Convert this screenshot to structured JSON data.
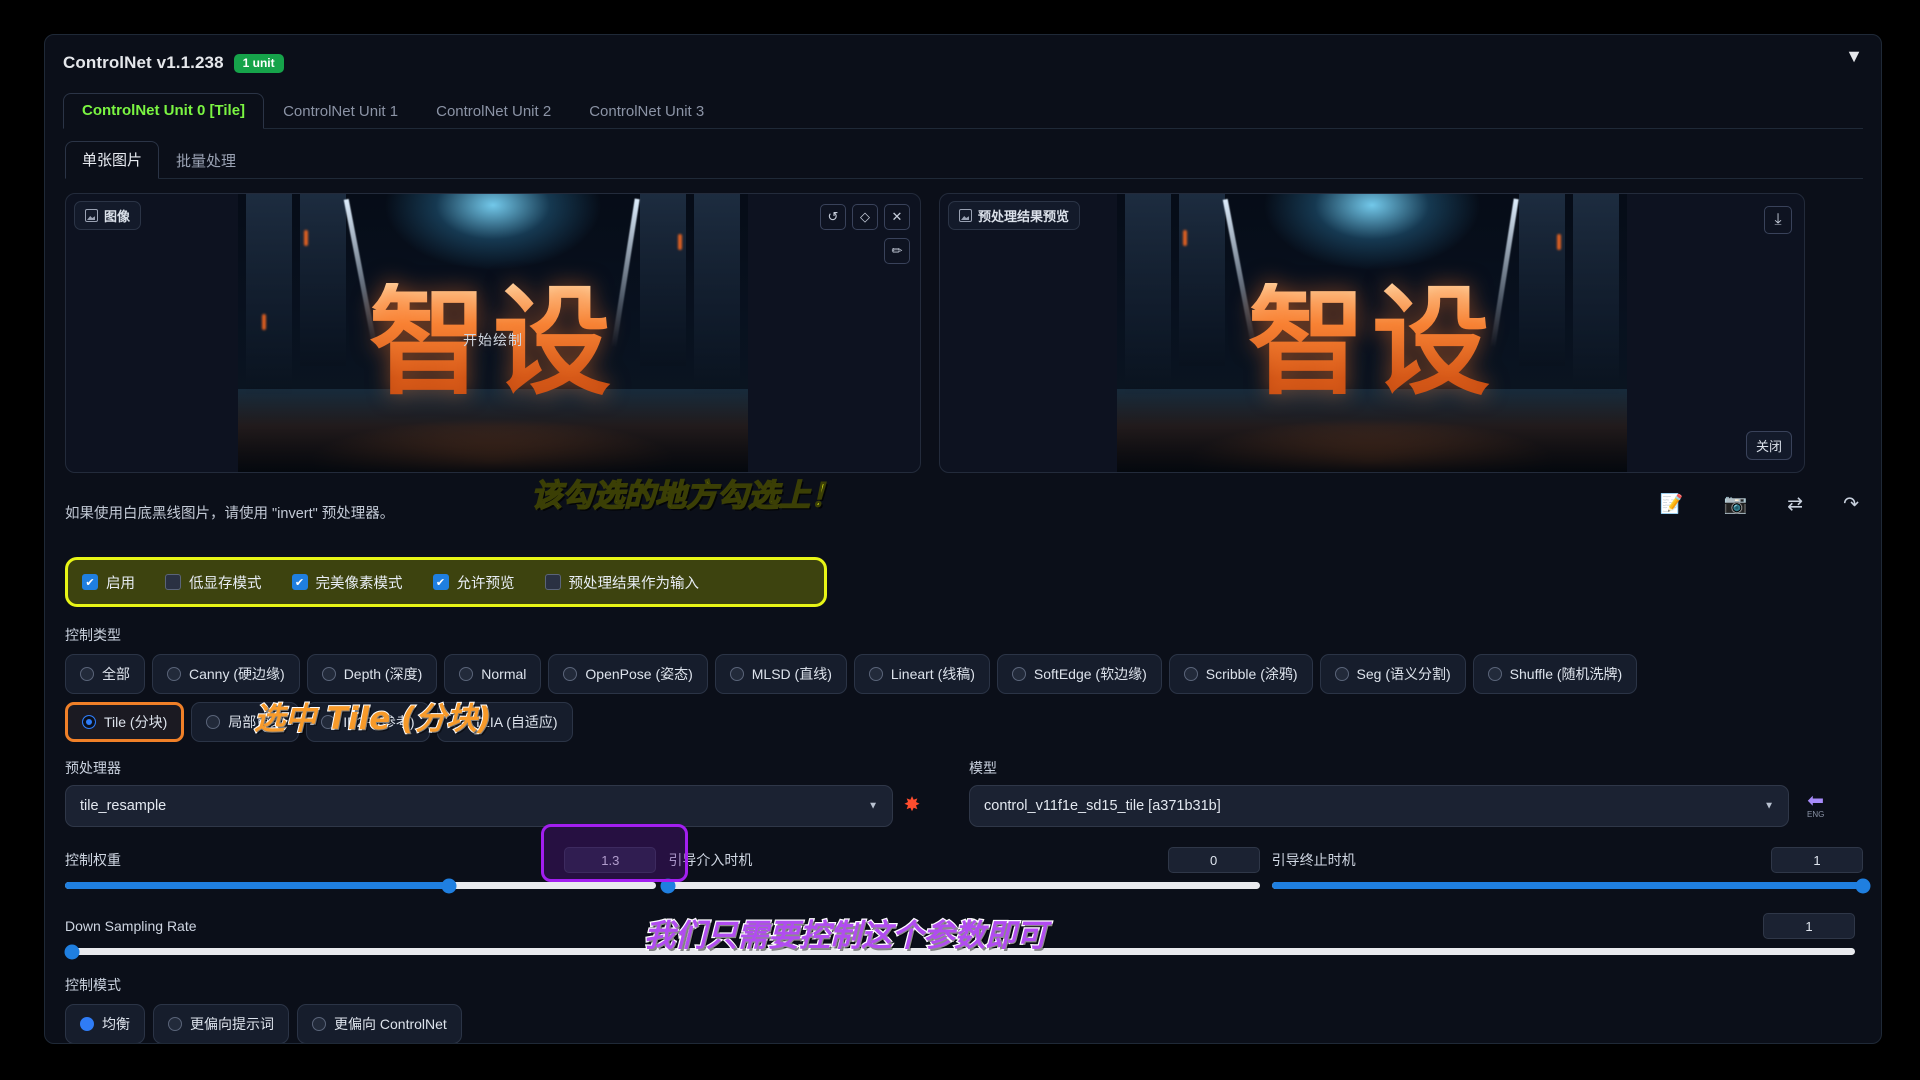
{
  "panel": {
    "title": "ControlNet v1.1.238",
    "badge": "1 unit",
    "collapse_icon": "▼",
    "badge_color": "#16a34a",
    "accent_green": "#7bf542"
  },
  "unit_tabs": [
    {
      "label": "ControlNet Unit 0 [Tile]",
      "active": true
    },
    {
      "label": "ControlNet Unit 1",
      "active": false
    },
    {
      "label": "ControlNet Unit 2",
      "active": false
    },
    {
      "label": "ControlNet Unit 3",
      "active": false
    }
  ],
  "sub_tabs": [
    {
      "label": "单张图片",
      "active": true
    },
    {
      "label": "批量处理",
      "active": false
    }
  ],
  "image_box": {
    "tag": "图像",
    "art_text": "智设",
    "art_sub": "开始绘制",
    "tools": [
      {
        "name": "undo-icon",
        "glyph": "↺"
      },
      {
        "name": "eraser-icon",
        "glyph": "◇"
      },
      {
        "name": "close-icon",
        "glyph": "✕"
      }
    ],
    "pen_tool": {
      "name": "pen-icon",
      "glyph": "✏"
    }
  },
  "preview_box": {
    "tag": "预处理结果预览",
    "art_text": "智设",
    "download_glyph": "⤓",
    "close_label": "关闭"
  },
  "hint": {
    "text": "如果使用白底黑线图片，请使用 \"invert\" 预处理器。",
    "icons": [
      {
        "name": "paste-prompt-icon",
        "glyph": "📝"
      },
      {
        "name": "camera-icon",
        "glyph": "📷"
      },
      {
        "name": "swap-icon",
        "glyph": "⇄"
      },
      {
        "name": "send-icon",
        "glyph": "↷"
      }
    ]
  },
  "checkboxes": [
    {
      "label": "启用",
      "checked": true
    },
    {
      "label": "低显存模式",
      "checked": false
    },
    {
      "label": "完美像素模式",
      "checked": true
    },
    {
      "label": "允许预览",
      "checked": true
    },
    {
      "label": "预处理结果作为输入",
      "checked": false
    }
  ],
  "control_type": {
    "label": "控制类型",
    "row1": [
      {
        "label": "全部",
        "selected": false
      },
      {
        "label": "Canny (硬边缘)",
        "selected": false
      },
      {
        "label": "Depth (深度)",
        "selected": false
      },
      {
        "label": "Normal",
        "selected": false
      },
      {
        "label": "OpenPose (姿态)",
        "selected": false
      },
      {
        "label": "MLSD (直线)",
        "selected": false
      },
      {
        "label": "Lineart (线稿)",
        "selected": false
      },
      {
        "label": "SoftEdge (软边缘)",
        "selected": false
      },
      {
        "label": "Scribble (涂鸦)",
        "selected": false
      },
      {
        "label": "Seg (语义分割)",
        "selected": false
      },
      {
        "label": "Shuffle (随机洗牌)",
        "selected": false
      }
    ],
    "row2": [
      {
        "label": "Tile (分块)",
        "selected": true
      },
      {
        "label": "局部重绘",
        "selected": false
      },
      {
        "label": "IP2P (参考)",
        "selected": false
      },
      {
        "label": "T2IA (自适应)",
        "selected": false
      }
    ]
  },
  "preprocessor": {
    "label": "预处理器",
    "value": "tile_resample",
    "caret": "▼"
  },
  "model": {
    "label": "模型",
    "value": "control_v11f1e_sd15_tile [a371b31b]",
    "caret": "▼"
  },
  "run_icon": {
    "name": "spark-icon",
    "glyph": "✸"
  },
  "back_icon": {
    "name": "back-arrow-icon",
    "glyph": "⬅",
    "sub": "ENG"
  },
  "sliders": [
    {
      "name": "控制权重",
      "value": "1.3",
      "fill_pct": 65
    },
    {
      "name": "引导介入时机",
      "value": "0",
      "fill_pct": 0
    },
    {
      "name": "引导终止时机",
      "value": "1",
      "fill_pct": 100
    },
    {
      "name": "Down Sampling Rate",
      "value": "1",
      "fill_pct": 0
    }
  ],
  "control_mode": {
    "label": "控制模式",
    "options": [
      {
        "label": "均衡",
        "selected": true
      },
      {
        "label": "更偏向提示词",
        "selected": false
      },
      {
        "label": "更偏向 ControlNet",
        "selected": false
      }
    ]
  },
  "annotations": [
    {
      "text": "该勾选的地方勾选上！",
      "style": "yellow"
    },
    {
      "text": "选中 Tile (分块)",
      "style": "orange"
    },
    {
      "text": "我们只需要控制这个参数即可",
      "style": "purple"
    }
  ]
}
